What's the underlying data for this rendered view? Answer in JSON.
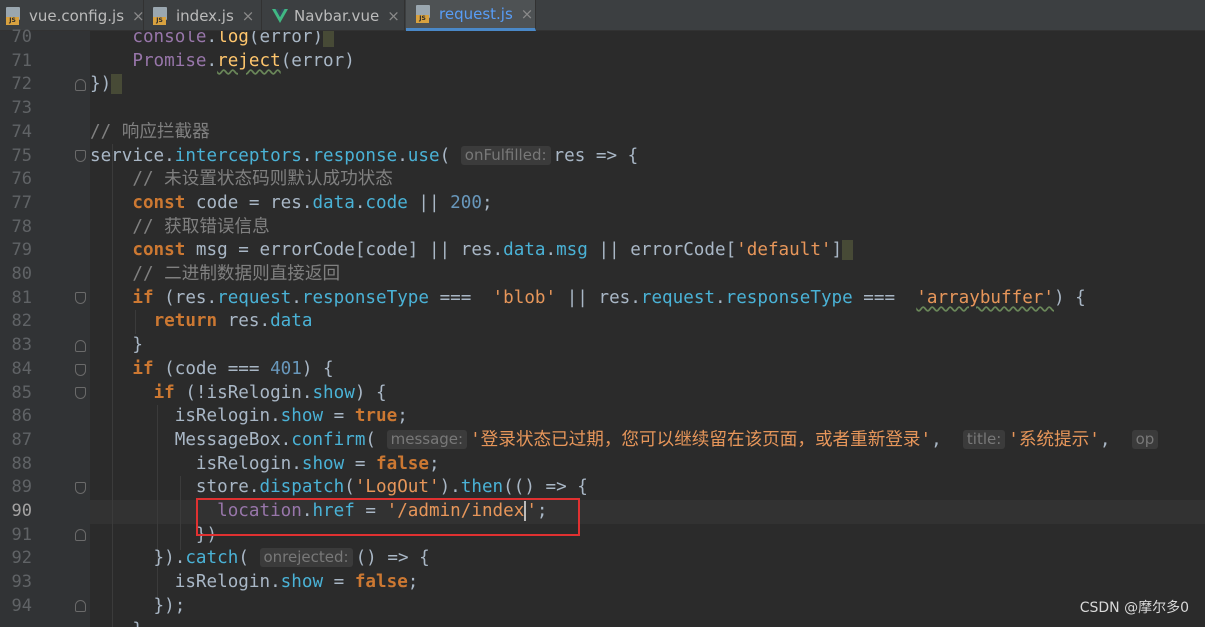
{
  "tabs": [
    {
      "label": "vue.config.js",
      "icon": "js-file-icon"
    },
    {
      "label": "index.js",
      "icon": "js-file-icon"
    },
    {
      "label": "Navbar.vue",
      "icon": "vue-file-icon"
    },
    {
      "label": "request.js",
      "icon": "js-file-icon",
      "active": true
    }
  ],
  "tab_close_glyph": "×",
  "editor": {
    "current_line": 90,
    "line_numbers": [
      "70",
      "71",
      "72",
      "73",
      "74",
      "75",
      "76",
      "77",
      "78",
      "79",
      "80",
      "81",
      "82",
      "83",
      "84",
      "85",
      "86",
      "87",
      "88",
      "89",
      "90",
      "91",
      "92",
      "93",
      "94"
    ],
    "hints": {
      "onFulfilled": "onFulfilled:",
      "message": "message:",
      "title": "title:",
      "op": "op",
      "onrejected": "onrejected:"
    },
    "strings": {
      "default": "'default'",
      "blob": "'blob'",
      "arraybuffer": "'arraybuffer'",
      "msgbox_msg": "'登录状态已过期，您可以继续留在该页面，或者重新登录'",
      "msgbox_title": "'系统提示'",
      "logout": "'LogOut'",
      "url": "'/admin/index"
    },
    "comments": {
      "c74": "// 响应拦截器",
      "c76": "// 未设置状态码则默认成功状态",
      "c78": "// 获取错误信息",
      "c80": "// 二进制数据则直接返回"
    },
    "numbers": {
      "n200": "200",
      "n401": "401"
    }
  },
  "colors": {
    "background": "#2b2b2b",
    "keyword": "#cc7832",
    "string": "#6a8759",
    "number": "#6897bb",
    "comment": "#808080",
    "property": "#9876aa",
    "highlight_box": "#e03131",
    "active_tab_text": "#589df6"
  },
  "watermark": "CSDN @摩尔多0"
}
